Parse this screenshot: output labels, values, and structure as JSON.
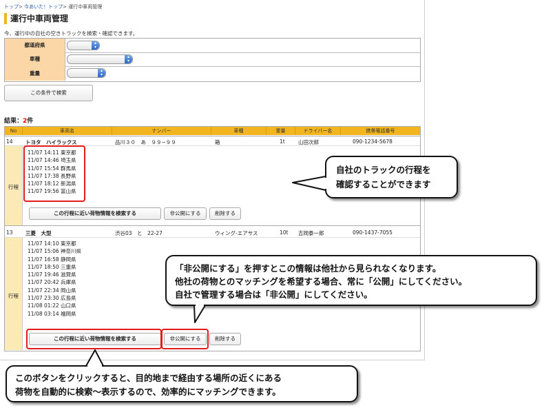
{
  "breadcrumb": {
    "items": [
      "トップ",
      "今あいた！トップ",
      "運行中車両管理"
    ],
    "sep": ">"
  },
  "page_title": "運行中車両管理",
  "description": "今、運行中の自社の空きトラックを検索・確認できます。",
  "form": {
    "fields": [
      {
        "label": "都道府県",
        "value": ""
      },
      {
        "label": "車種",
        "value": ""
      },
      {
        "label": "重量",
        "value": ""
      }
    ],
    "search_button": "この条件で検索"
  },
  "results": {
    "label": "結果：",
    "count": "2",
    "unit": "件"
  },
  "table": {
    "headers": [
      "No",
      "車両名",
      "ナンバー",
      "車種",
      "重量",
      "ドライバー名",
      "携帯電話番号"
    ],
    "schedule_label": "行程",
    "rows": [
      {
        "no": "14",
        "vehicle": "トヨタ　ハイラックス",
        "plate": "品川３０　あ　９９−９９",
        "type": "箱",
        "weight": "1t",
        "driver": "山田次郎",
        "phone": "090-1234-5678",
        "schedule": [
          "11/07 14:11 東京都",
          "11/07 14:46 埼玉県",
          "11/07 15:54 群馬県",
          "11/07 17:38 長野県",
          "11/07 18:12 新潟県",
          "11/07 19:56 富山県"
        ]
      },
      {
        "no": "13",
        "vehicle": "三菱　大型",
        "plate": "渋谷03　と　22-27",
        "type": "ウィング-エアサス",
        "weight": "10t",
        "driver": "吉岡泰一郎",
        "phone": "090-1437-7055",
        "schedule": [
          "11/07 14:10 東京都",
          "11/07 15:06 神奈川県",
          "11/07 16:58 静岡県",
          "11/07 18:50 三重県",
          "11/07 19:46 滋賀県",
          "11/07 20:42 兵庫県",
          "11/07 22:34 岡山県",
          "11/07 23:30 広島県",
          "11/08 01:22 山口県",
          "11/08 03:14 福岡県"
        ]
      }
    ],
    "row_buttons": {
      "search": "この行程に近い荷物情報を検索する",
      "private": "非公開にする",
      "delete": "削除する"
    }
  },
  "callouts": {
    "schedule": [
      "自社のトラックの行程を",
      "確認することができます"
    ],
    "private": [
      "「非公開にする」を押すとこの情報は他社から見られなくなります。",
      "他社の荷物とのマッチングを希望する場合、常に「公開」にしてください。",
      "自社で管理する場合は「非公開」にしてください。"
    ],
    "search": [
      "このボタンをクリックすると、目的地まで経由する場所の近くにある",
      "荷物を自動的に検索〜表示するので、効率的にマッチングできます。"
    ]
  },
  "colors": {
    "accent": "#f2b51f",
    "label_bg": "#fbd6a6",
    "schedule_bg": "#fbe9b6",
    "highlight": "#e21b1b",
    "count": "#e60000"
  }
}
